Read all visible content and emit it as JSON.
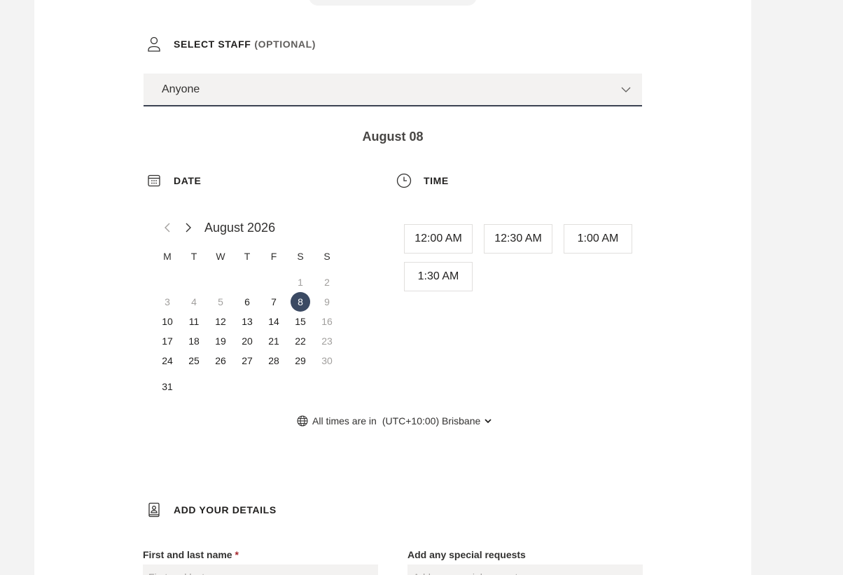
{
  "staff": {
    "label": "SELECT STAFF",
    "optional": "(OPTIONAL)",
    "selected": "Anyone"
  },
  "selected_date": "August 08",
  "date_section": {
    "label": "DATE"
  },
  "time_section": {
    "label": "TIME"
  },
  "calendar": {
    "month": "August 2026",
    "weekdays": [
      "M",
      "T",
      "W",
      "T",
      "F",
      "S",
      "S"
    ],
    "days": {
      "d1": "1",
      "d2": "2",
      "d3": "3",
      "d4": "4",
      "d5": "5",
      "d6": "6",
      "d7": "7",
      "d8": "8",
      "d9": "9",
      "d10": "10",
      "d11": "11",
      "d12": "12",
      "d13": "13",
      "d14": "14",
      "d15": "15",
      "d16": "16",
      "d17": "17",
      "d18": "18",
      "d19": "19",
      "d20": "20",
      "d21": "21",
      "d22": "22",
      "d23": "23",
      "d24": "24",
      "d25": "25",
      "d26": "26",
      "d27": "27",
      "d28": "28",
      "d29": "29",
      "d30": "30",
      "d31": "31"
    }
  },
  "times": [
    "12:00 AM",
    "12:30 AM",
    "1:00 AM",
    "1:30 AM"
  ],
  "timezone": {
    "prefix": "All times are in",
    "zone": "(UTC+10:00) Brisbane"
  },
  "details": {
    "label": "ADD YOUR DETAILS",
    "name_label": "First and last name",
    "required_mark": "*",
    "name_placeholder": "First and last name",
    "requests_label": "Add any special requests",
    "requests_placeholder": "Add any special requests"
  },
  "colors": {
    "accent": "#3b4a63",
    "disabled_text": "#a19f9d",
    "input_bg": "#f3f2f1"
  }
}
